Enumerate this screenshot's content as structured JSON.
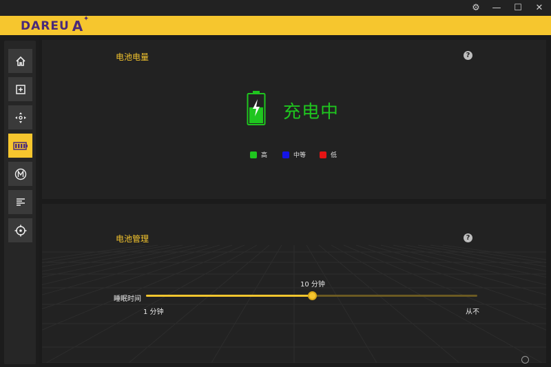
{
  "window": {
    "settings_icon": "gear-icon",
    "minimize_label": "—",
    "maximize_label": "☐",
    "close_label": "✕"
  },
  "brand": {
    "logo_text": "DAREU",
    "logo_mark": "A",
    "color": "#f6c62e",
    "logo_color": "#4a2a7a"
  },
  "sidebar": {
    "items": [
      {
        "name": "home-icon",
        "active": false
      },
      {
        "name": "add-key-icon",
        "active": false
      },
      {
        "name": "directional-pad-icon",
        "active": false
      },
      {
        "name": "battery-icon",
        "active": true
      },
      {
        "name": "macro-m-icon",
        "active": false
      },
      {
        "name": "text-align-icon",
        "active": false
      },
      {
        "name": "crosshair-icon",
        "active": false
      }
    ]
  },
  "battery": {
    "title": "电池电量",
    "status": "充电中",
    "status_color": "#1fc51f",
    "level": 0.55,
    "legend": [
      {
        "label": "高",
        "color": "#1fc51f"
      },
      {
        "label": "中等",
        "color": "#1414e6"
      },
      {
        "label": "低",
        "color": "#e61414"
      }
    ]
  },
  "management": {
    "title": "电池管理",
    "sleep_label": "睡眠时间",
    "current_value": "10 分钟",
    "min_label": "1 分钟",
    "max_label": "从不",
    "slider_fraction": 0.5
  }
}
